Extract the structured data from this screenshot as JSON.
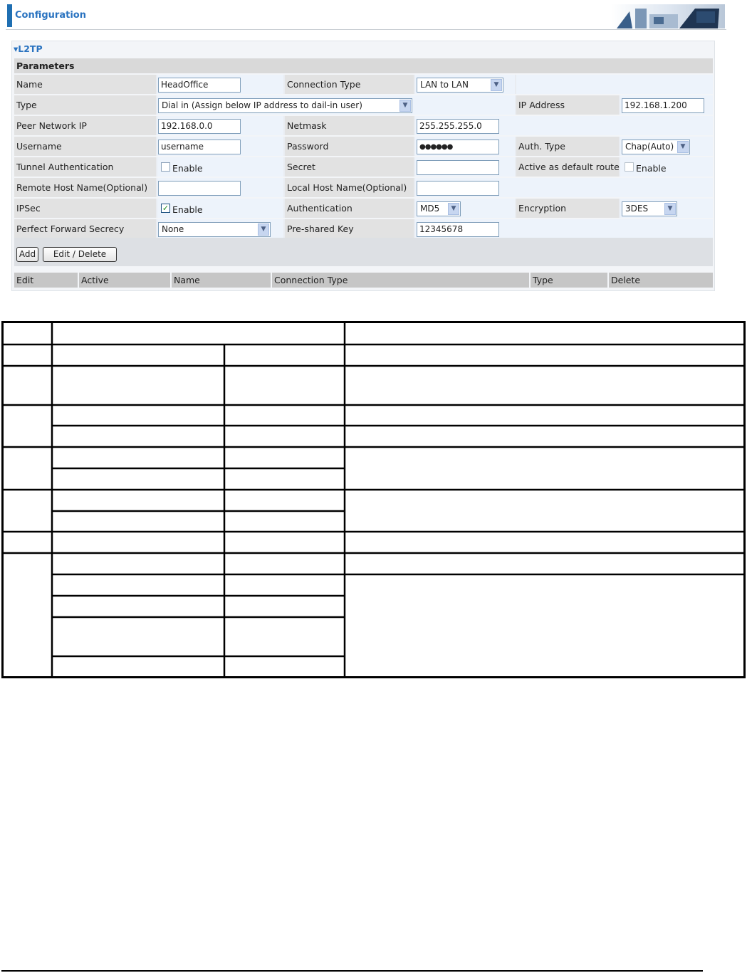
{
  "header": {
    "title": "Configuration"
  },
  "section": {
    "title": "▾L2TP",
    "parameters_heading": "Parameters"
  },
  "fields": {
    "name": {
      "label": "Name",
      "value": "HeadOffice"
    },
    "connection_type": {
      "label": "Connection Type",
      "value": "LAN to LAN"
    },
    "type": {
      "label": "Type",
      "value": "Dial in (Assign below IP address to dail-in user)"
    },
    "ip_address": {
      "label": "IP Address",
      "value": "192.168.1.200"
    },
    "peer_network_ip": {
      "label": "Peer Network IP",
      "value": "192.168.0.0"
    },
    "netmask": {
      "label": "Netmask",
      "value": "255.255.255.0"
    },
    "username": {
      "label": "Username",
      "value": "username"
    },
    "password": {
      "label": "Password",
      "value": "●●●●●●"
    },
    "auth_type": {
      "label": "Auth. Type",
      "value": "Chap(Auto)"
    },
    "tunnel_authentication": {
      "label": "Tunnel Authentication",
      "checkbox_label": "Enable",
      "checked": false
    },
    "secret": {
      "label": "Secret",
      "value": ""
    },
    "active_default_route": {
      "label": "Active as default route",
      "checkbox_label": "Enable",
      "checked": false
    },
    "remote_host_name": {
      "label": "Remote Host Name(Optional)",
      "value": ""
    },
    "local_host_name": {
      "label": "Local Host Name(Optional)",
      "value": ""
    },
    "ipsec": {
      "label": "IPSec",
      "checkbox_label": "Enable",
      "checked": true
    },
    "authentication": {
      "label": "Authentication",
      "value": "MD5"
    },
    "encryption": {
      "label": "Encryption",
      "value": "3DES"
    },
    "pfs": {
      "label": "Perfect Forward Secrecy",
      "value": "None"
    },
    "pre_shared_key": {
      "label": "Pre-shared Key",
      "value": "12345678"
    }
  },
  "buttons": {
    "add": "Add",
    "edit_delete": "Edit / Delete"
  },
  "list_columns": [
    "Edit",
    "Active",
    "Name",
    "Connection Type",
    "Type",
    "Delete"
  ],
  "colors": {
    "accent": "#2a73c0",
    "header_bar": "#1f6fb2"
  }
}
